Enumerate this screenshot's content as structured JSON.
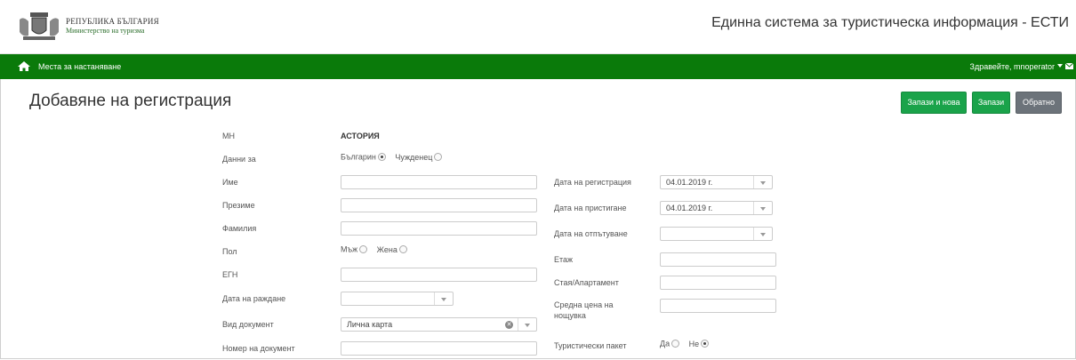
{
  "header": {
    "org_line1": "РЕПУБЛИКА БЪЛГАРИЯ",
    "org_line2": "Министерство на туризма",
    "system_title": "Единна система за туристическа информация - ЕСТИ"
  },
  "nav": {
    "link": "Места за настаняване",
    "greeting": "Здравейте, mnoperator"
  },
  "page": {
    "title": "Добавяне на регистрация",
    "buttons": {
      "save_new": "Запази и нова",
      "save": "Запази",
      "back": "Обратно"
    }
  },
  "form": {
    "mh_label": "МН",
    "mh_value": "АСТОРИЯ",
    "data_for_label": "Данни за",
    "data_for_options": {
      "bg": "Българин",
      "foreign": "Чужденец"
    },
    "first_name_label": "Име",
    "middle_name_label": "Презиме",
    "last_name_label": "Фамилия",
    "gender_label": "Пол",
    "gender_options": {
      "male": "Мъж",
      "female": "Жена"
    },
    "egn_label": "ЕГН",
    "birth_date_label": "Дата на раждане",
    "doc_type_label": "Вид документ",
    "doc_type_value": "Лична карта",
    "doc_number_label": "Номер на документ",
    "reg_date_label": "Дата на регистрация",
    "reg_date_value": "04.01.2019 г.",
    "arrival_date_label": "Дата на пристигане",
    "arrival_date_value": "04.01.2019 г.",
    "departure_date_label": "Дата на отпътуване",
    "floor_label": "Етаж",
    "room_label": "Стая/Апартамент",
    "avg_price_label_l1": "Средна цена на",
    "avg_price_label_l2": "нощувка",
    "tour_package_label": "Туристически пакет",
    "tour_package_options": {
      "yes": "Да",
      "no": "Не"
    }
  },
  "colors": {
    "nav_green": "#0a7a0a",
    "btn_green": "#1aa34a",
    "btn_gray": "#6c737a"
  }
}
